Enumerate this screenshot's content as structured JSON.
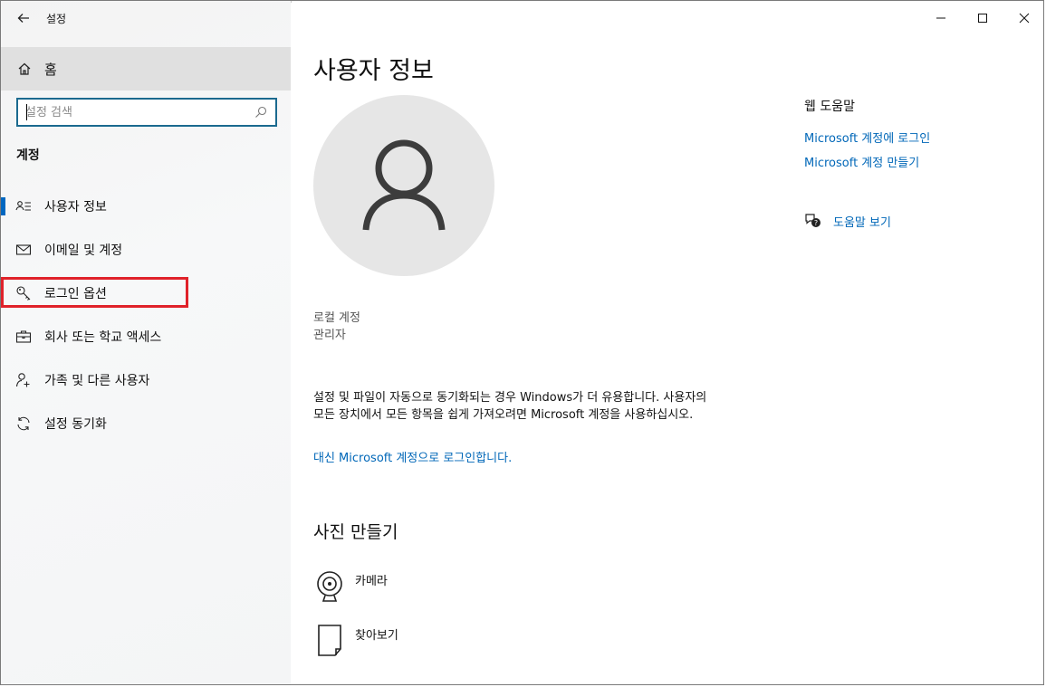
{
  "window": {
    "title": "설정",
    "back_icon": "back-arrow-icon"
  },
  "sidebar": {
    "home_label": "홈",
    "search_placeholder": "설정 검색",
    "section_title": "계정",
    "items": [
      {
        "label": "사용자 정보",
        "icon": "user-info-icon",
        "selected": true
      },
      {
        "label": "이메일 및 계정",
        "icon": "mail-icon"
      },
      {
        "label": "로그인 옵션",
        "icon": "key-icon"
      },
      {
        "label": "회사 또는 학교 액세스",
        "icon": "briefcase-icon"
      },
      {
        "label": "가족 및 다른 사용자",
        "icon": "person-add-icon"
      },
      {
        "label": "설정 동기화",
        "icon": "sync-icon"
      }
    ]
  },
  "main": {
    "title": "사용자 정보",
    "account_type": "로컬 계정",
    "account_role": "관리자",
    "sync_text": "설정 및 파일이 자동으로 동기화되는 경우 Windows가 더 유용합니다. 사용자의 모든 장치에서 모든 항목을 쉽게 가져오려면 Microsoft 계정을 사용하십시오.",
    "ms_link": "대신 Microsoft 계정으로 로그인합니다.",
    "photo_section_title": "사진 만들기",
    "photo_items": [
      {
        "label": "카메라",
        "icon": "camera-icon"
      },
      {
        "label": "찾아보기",
        "icon": "browse-icon"
      }
    ]
  },
  "help": {
    "title": "웹 도움말",
    "links": [
      "Microsoft 계정에 로그인",
      "Microsoft 계정 만들기"
    ],
    "view_help": "도움말 보기"
  },
  "colors": {
    "accent": "#0067b8",
    "highlight_box": "#e0222a",
    "sidebar_bg": "#f3f3f3"
  }
}
